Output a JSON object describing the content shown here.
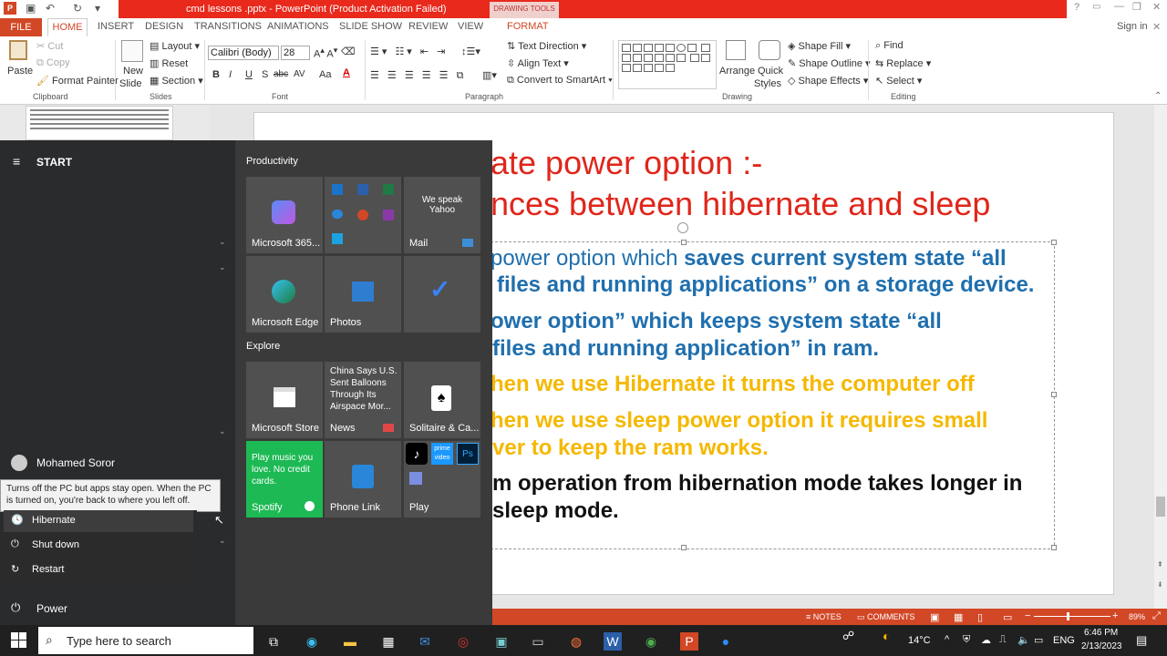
{
  "title_bar": {
    "title": "cmd lessons .pptx -  PowerPoint (Product Activation Failed)",
    "context_tab": "DRAWING TOOLS",
    "help": "?",
    "window_controls": [
      "—",
      "❐",
      "✕"
    ]
  },
  "ribbon_tabs": {
    "file": "FILE",
    "items": [
      "HOME",
      "INSERT",
      "DESIGN",
      "TRANSITIONS",
      "ANIMATIONS",
      "SLIDE SHOW",
      "REVIEW",
      "VIEW",
      "FORMAT"
    ],
    "signin": "Sign in"
  },
  "ribbon": {
    "clipboard": {
      "paste": "Paste",
      "cut": "Cut",
      "copy": "Copy",
      "format_painter": "Format Painter",
      "label": "Clipboard"
    },
    "slides": {
      "new_slide": "New",
      "new_slide2": "Slide",
      "layout": "Layout",
      "reset": "Reset",
      "section": "Section",
      "label": "Slides"
    },
    "font": {
      "name": "Calibri (Body)",
      "size": "28",
      "bold": "B",
      "italic": "I",
      "underline": "U",
      "strike": "S",
      "shadow": "abc",
      "spacing": "AV",
      "case": "Aa",
      "color": "A",
      "label": "Font"
    },
    "paragraph": {
      "text_direction": "Text Direction",
      "align_text": "Align Text",
      "convert": "Convert to SmartArt",
      "label": "Paragraph"
    },
    "drawing": {
      "arrange": "Arrange",
      "quick_styles": "Quick",
      "quick_styles2": "Styles",
      "shape_fill": "Shape Fill",
      "shape_outline": "Shape Outline",
      "shape_effects": "Shape Effects",
      "label": "Drawing"
    },
    "editing": {
      "find": "Find",
      "replace": "Replace",
      "select": "Select",
      "label": "Editing"
    }
  },
  "slide": {
    "title_line1": "ate power option :-",
    "title_line2": "nces between hibernate and sleep",
    "bullets": [
      {
        "line1_a": "power option which ",
        "line1_b": "saves current system state “all",
        "line2": "files and running applications” on a storage device.",
        "color": "#1f6fae"
      },
      {
        "line1": "ower option” which keeps system state “all",
        "line2": "files and running application” in ram.",
        "color": "#1f6fae"
      },
      {
        "line1": "hen we use Hibernate it turns the computer off",
        "color": "#f5b800"
      },
      {
        "line1": "hen we use sleep power option it requires small",
        "line2": "ver to keep the ram works.",
        "color": "#f5b800"
      },
      {
        "line1": "m operation from hibernation mode takes longer in",
        "line2": "sleep mode.",
        "color": "#111111"
      }
    ],
    "accent_title_color": "#e0261b"
  },
  "status_bar": {
    "notes": "NOTES",
    "comments": "COMMENTS",
    "zoom": "89%"
  },
  "start_menu": {
    "header": "START",
    "user": "Mohamed Soror",
    "power": "Power",
    "tooltip": "Turns off the PC but apps stay open. When the PC is turned on, you're back to where you left off.",
    "power_options": [
      "Hibernate",
      "Shut down",
      "Restart"
    ],
    "section_productivity": "Productivity",
    "section_explore": "Explore",
    "tiles": {
      "m365": "Microsoft 365...",
      "mail": "Mail",
      "mail_text": "We speak Yahoo",
      "edge": "Microsoft Edge",
      "photos": "Photos",
      "store": "Microsoft Store",
      "news": "News",
      "news_text": "China Says U.S. Sent Balloons Through Its Airspace Mor...",
      "solitaire": "Solitaire & Ca...",
      "spotify": "Spotify",
      "spotify_text": "Play music you love. No credit cards.",
      "phone_link": "Phone Link",
      "play": "Play",
      "prime": "prime video"
    }
  },
  "taskbar": {
    "search_placeholder": "Type here to search",
    "weather": "14°C",
    "lang": "ENG",
    "time": "6:46 PM",
    "date": "2/13/2023"
  },
  "colors": {
    "ppt_red": "#d24726",
    "title_red": "#e8291c",
    "spotify_green": "#1db954"
  }
}
